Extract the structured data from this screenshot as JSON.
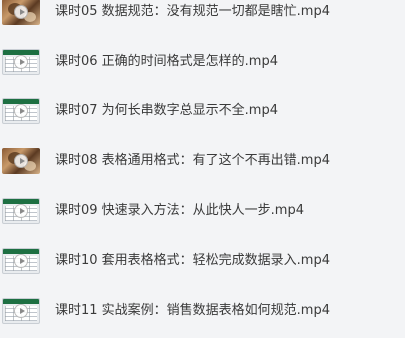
{
  "playlist": {
    "items": [
      {
        "label": "课时05 数据规范：没有规范一切都是瞎忙.mp4",
        "thumb": "photo"
      },
      {
        "label": "课时06 正确的时间格式是怎样的.mp4",
        "thumb": "excel"
      },
      {
        "label": "课时07 为何长串数字总显示不全.mp4",
        "thumb": "excel"
      },
      {
        "label": "课时08 表格通用格式：有了这个不再出错.mp4",
        "thumb": "photo"
      },
      {
        "label": "课时09 快速录入方法：从此快人一步.mp4",
        "thumb": "excel"
      },
      {
        "label": "课时10 套用表格格式：轻松完成数据录入.mp4",
        "thumb": "excel"
      },
      {
        "label": "课时11 实战案例：销售数据表格如何规范.mp4",
        "thumb": "excel"
      }
    ]
  },
  "icons": {
    "play": "play-icon",
    "video_thumbnail": "video-thumbnail-icon"
  }
}
